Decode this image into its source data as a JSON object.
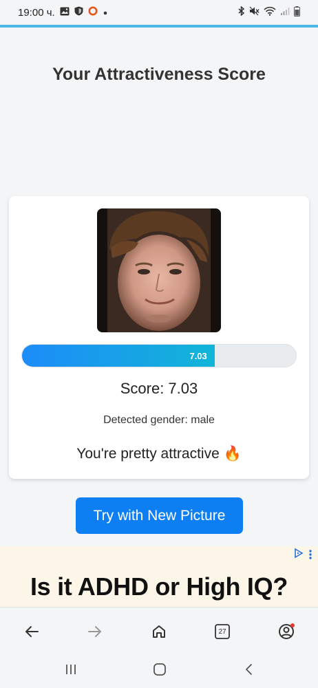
{
  "status_bar": {
    "time": "19:00 ч.",
    "icons_left": [
      "gallery-icon",
      "shield-icon",
      "circle-app-icon",
      "dot-icon"
    ],
    "icons_right": [
      "bluetooth-icon",
      "mute-icon",
      "wifi-icon",
      "signal-icon",
      "battery-icon"
    ]
  },
  "page": {
    "title": "Your Attractiveness Score"
  },
  "result": {
    "photo": "face-photo",
    "progress_percent": 70.3,
    "progress_label": "7.03",
    "score_text": "Score: 7.03",
    "gender_text": "Detected gender: male",
    "verdict_text": "You're pretty attractive 🔥"
  },
  "actions": {
    "try_label": "Try with New Picture"
  },
  "ad": {
    "headline": "Is it ADHD or High IQ?",
    "choices_icon": "ad-choices-icon",
    "menu_icon": "more-vert-icon"
  },
  "browser_nav": {
    "tabs_count": "27",
    "items": [
      "back-icon",
      "forward-icon",
      "home-icon",
      "tabs-icon",
      "account-icon"
    ]
  },
  "system_nav": {
    "items": [
      "recents-icon",
      "home-circle-icon",
      "back-chevron-icon"
    ]
  },
  "colors": {
    "accent": "#4db6e6",
    "button": "#0d7ff2",
    "progress_start": "#1d8cf8",
    "progress_end": "#12b5d8"
  }
}
